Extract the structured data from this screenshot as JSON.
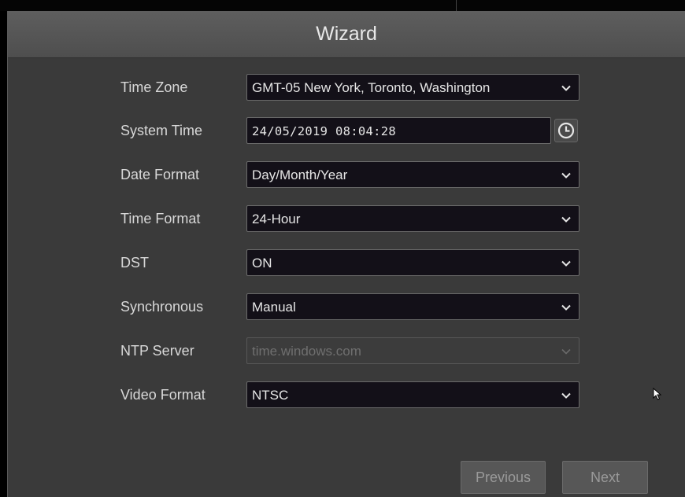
{
  "window": {
    "title": "Wizard"
  },
  "form": {
    "time_zone": {
      "label": "Time Zone",
      "value": "GMT-05 New York, Toronto, Washington"
    },
    "system_time": {
      "label": "System Time",
      "value": "24/05/2019 08:04:28"
    },
    "date_format": {
      "label": "Date Format",
      "value": "Day/Month/Year"
    },
    "time_format": {
      "label": "Time Format",
      "value": "24-Hour"
    },
    "dst": {
      "label": "DST",
      "value": "ON"
    },
    "synchronous": {
      "label": "Synchronous",
      "value": "Manual"
    },
    "ntp_server": {
      "label": "NTP Server",
      "value": "time.windows.com",
      "disabled": true
    },
    "video_format": {
      "label": "Video Format",
      "value": "NTSC"
    }
  },
  "buttons": {
    "previous": "Previous",
    "next": "Next"
  },
  "icons": {
    "dropdown": "chevron-down-icon",
    "clock": "clock-icon",
    "cursor": "mouse-pointer-icon"
  },
  "colors": {
    "background": "#3a3a3a",
    "field": "#131018",
    "titlebar": "#575757"
  }
}
